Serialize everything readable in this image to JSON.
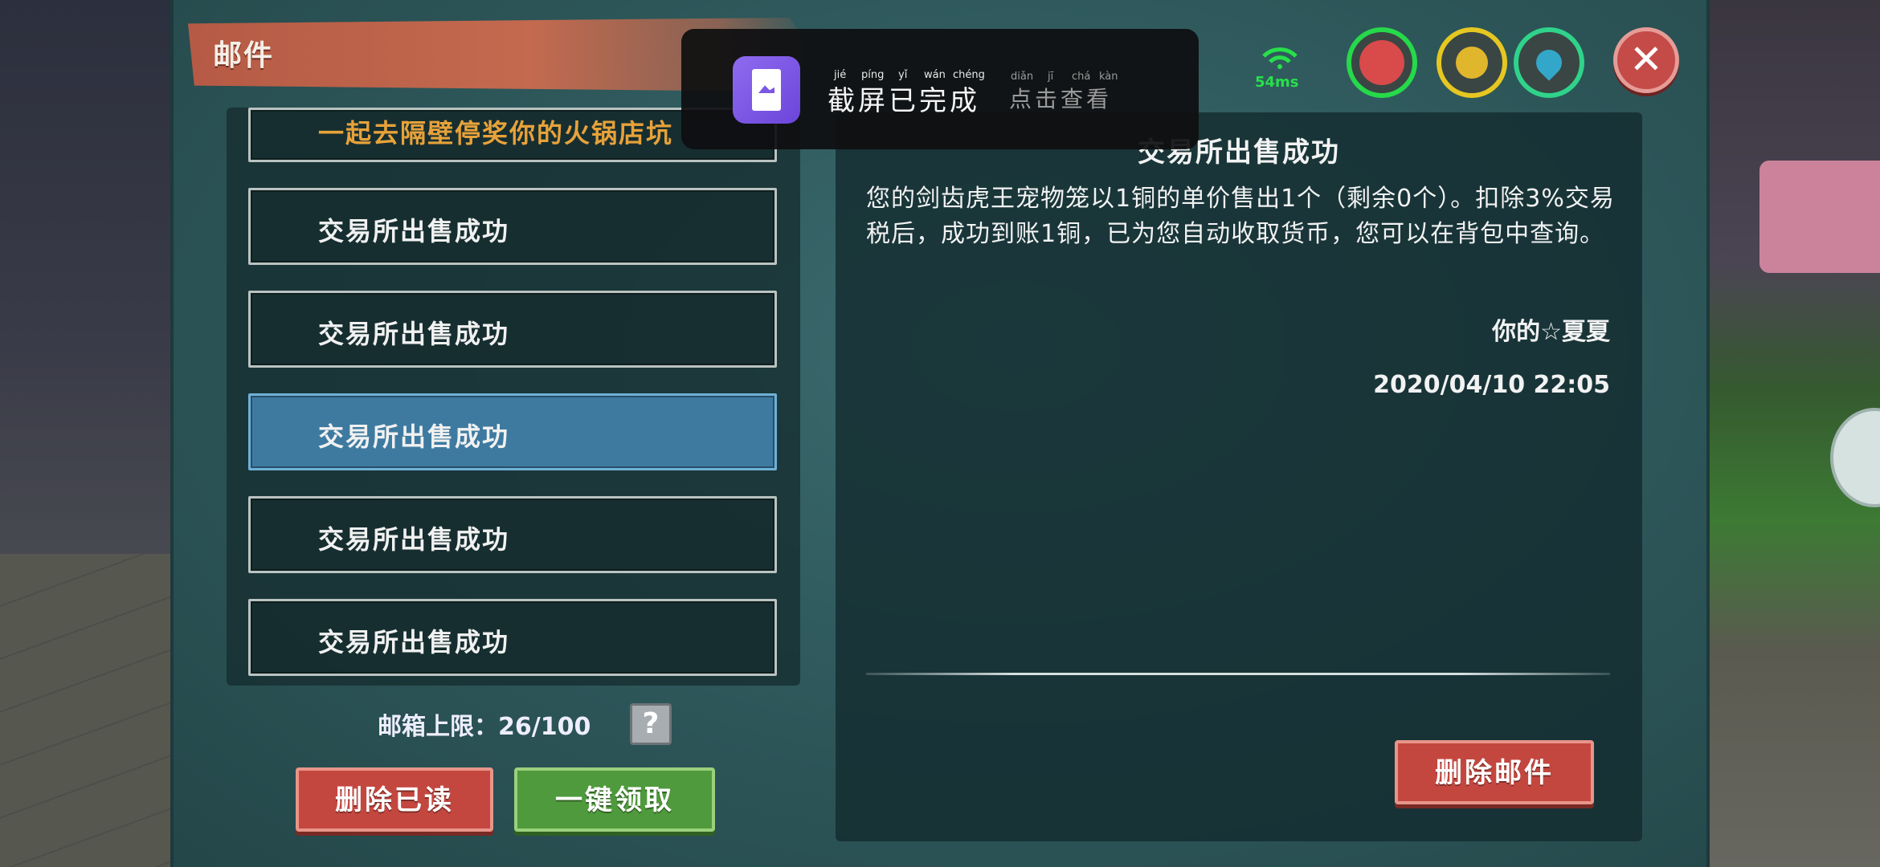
{
  "window": {
    "title": "邮件"
  },
  "toast": {
    "main_text": "截屏已完成",
    "pinyin": [
      "jié",
      "píng",
      "yǐ",
      "wán",
      "chéng"
    ],
    "sub_text": "点击查看",
    "sub_pinyin": [
      "diǎn",
      "jī",
      "chá",
      "kàn"
    ]
  },
  "hud": {
    "ping": "54ms",
    "icons": [
      "wifi-icon",
      "heart-icon",
      "banana-icon",
      "water-drop-icon",
      "close-icon"
    ]
  },
  "mail_list": {
    "items": [
      {
        "label": "一起去隔壁停奖你的火锅店坑",
        "selected": false,
        "partial": true
      },
      {
        "label": "交易所出售成功",
        "selected": false
      },
      {
        "label": "交易所出售成功",
        "selected": false
      },
      {
        "label": "交易所出售成功",
        "selected": true
      },
      {
        "label": "交易所出售成功",
        "selected": false
      },
      {
        "label": "交易所出售成功",
        "selected": false
      }
    ],
    "quota_label": "邮箱上限：26/100",
    "help_label": "?",
    "delete_read_label": "删除已读",
    "claim_all_label": "一键领取"
  },
  "detail": {
    "title": "交易所出售成功",
    "body": "您的剑齿虎王宠物笼以1铜的单价售出1个（剩余0个）。扣除3%交易税后，成功到账1铜，已为您自动收取货币，您可以在背包中查询。",
    "sender": "你的☆夏夏",
    "date": "2020/04/10 22:05",
    "delete_label": "删除邮件"
  },
  "colors": {
    "selected_item": "#3e7aa0",
    "red_button": "#c4473f",
    "green_button": "#4f9a3c",
    "ping_green": "#27e04a"
  }
}
